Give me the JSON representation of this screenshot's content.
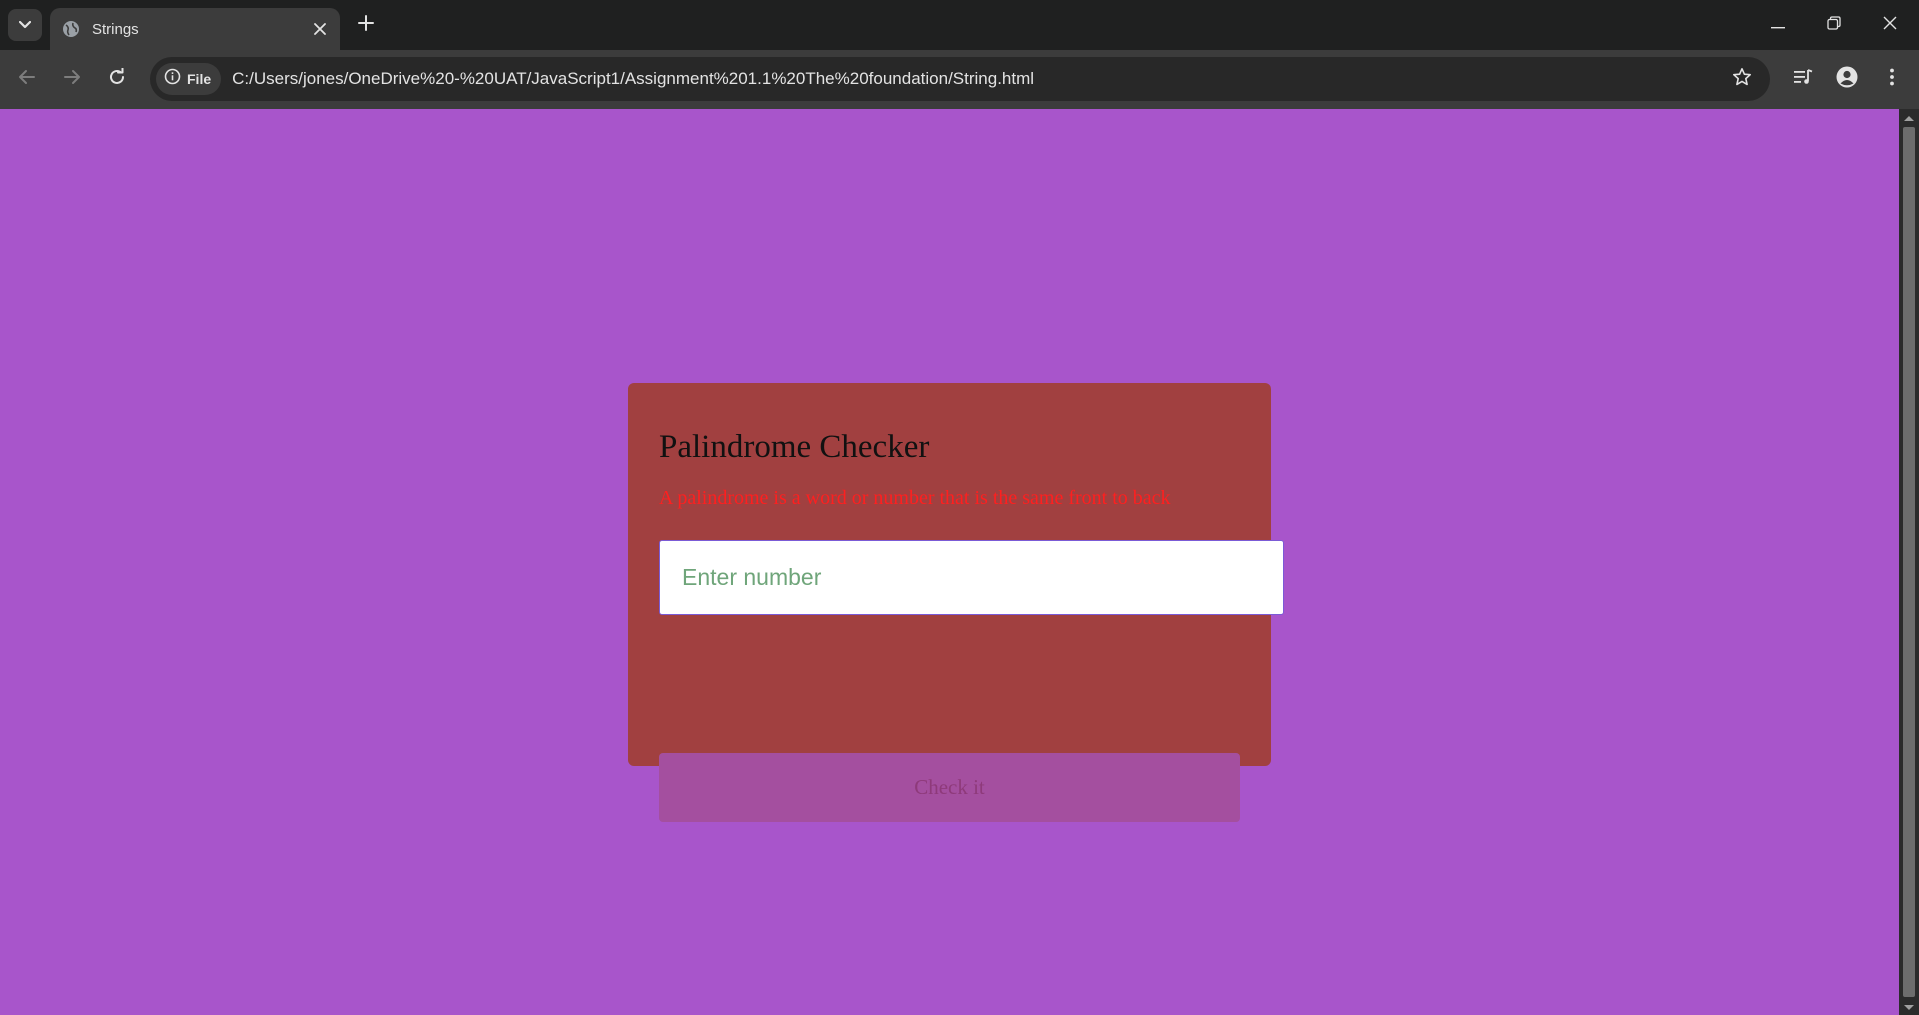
{
  "browser": {
    "tab": {
      "title": "Strings"
    },
    "omnibox": {
      "site_chip_label": "File",
      "url": "C:/Users/jones/OneDrive%20-%20UAT/JavaScript1/Assignment%201.1%20The%20foundation/String.html"
    }
  },
  "page": {
    "background_color": "#a855cb",
    "card": {
      "title": "Palindrome Checker",
      "description": "A palindrome is a word or number that is the same front to back",
      "input_placeholder": "Enter number",
      "input_value": "",
      "button_label": "Check it",
      "card_color": "#a14040",
      "description_color": "#ff1f1f"
    }
  }
}
